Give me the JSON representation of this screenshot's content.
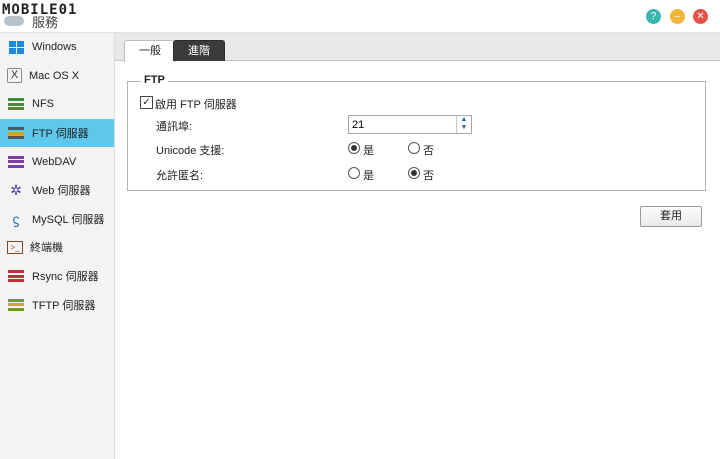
{
  "titlebar": {
    "watermark": "MOBILE01",
    "app_title": "服務"
  },
  "sidebar": {
    "items": [
      {
        "label": "Windows",
        "icon": "windows-icon"
      },
      {
        "label": "Mac OS X",
        "icon": "mac-finder-icon"
      },
      {
        "label": "NFS",
        "icon": "nfs-server-icon"
      },
      {
        "label": "FTP 伺服器",
        "icon": "ftp-server-icon"
      },
      {
        "label": "WebDAV",
        "icon": "webdav-icon"
      },
      {
        "label": "Web 伺服器",
        "icon": "web-server-icon"
      },
      {
        "label": "MySQL 伺服器",
        "icon": "mysql-icon"
      },
      {
        "label": "終端機",
        "icon": "terminal-icon"
      },
      {
        "label": "Rsync 伺服器",
        "icon": "rsync-icon"
      },
      {
        "label": "TFTP 伺服器",
        "icon": "tftp-icon"
      }
    ],
    "active_index": 3
  },
  "tabs": {
    "general": "一般",
    "advanced": "進階"
  },
  "ftp": {
    "legend": "FTP",
    "enable_label": "啟用 FTP 伺服器",
    "enable_checked": true,
    "port_label": "通訊埠:",
    "port_value": "21",
    "unicode_label": "Unicode 支援:",
    "unicode_yes": "是",
    "unicode_no": "否",
    "unicode_selected": "yes",
    "anonymous_label": "允許匿名:",
    "anonymous_yes": "是",
    "anonymous_no": "否",
    "anonymous_selected": "no"
  },
  "apply_label": "套用",
  "colors": {
    "sidebar_active": "#5ec8ec",
    "help": "#3ab6b0",
    "minimize": "#f2b53a",
    "close": "#e6514a"
  }
}
